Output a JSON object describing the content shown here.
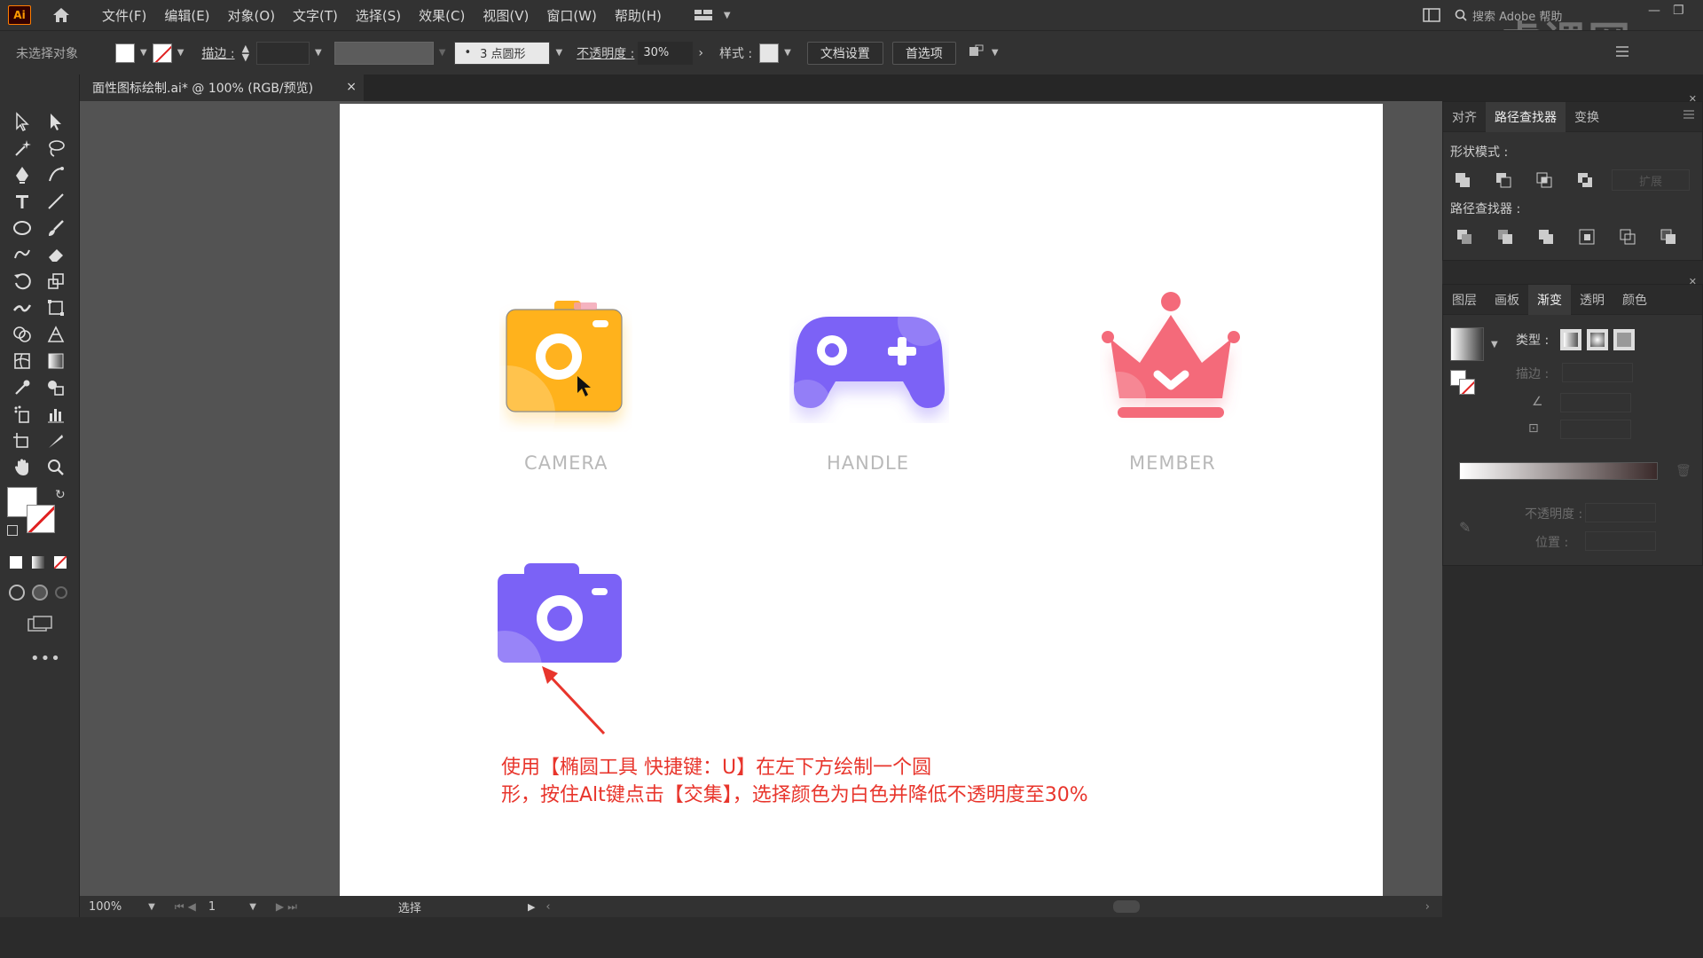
{
  "menubar": {
    "logo": "Ai",
    "items": [
      "文件(F)",
      "编辑(E)",
      "对象(O)",
      "文字(T)",
      "选择(S)",
      "效果(C)",
      "视图(V)",
      "窗口(W)",
      "帮助(H)"
    ],
    "search_placeholder": "搜索 Adobe 帮助"
  },
  "watermark": "虎课网",
  "control": {
    "no_selection": "未选择对象",
    "stroke_label": "描边 :",
    "brush": "3 点圆形",
    "opacity_label": "不透明度 :",
    "opacity_value": "30%",
    "style_label": "样式 :",
    "doc_setup": "文档设置",
    "prefs": "首选项"
  },
  "document": {
    "tab_title": "面性图标绘制.ai* @ 100% (RGB/预览)",
    "close": "×"
  },
  "artboard": {
    "labels": [
      "CAMERA",
      "HANDLE",
      "MEMBER"
    ],
    "instruction_line1": "使用【椭圆工具 快捷键：U】在左下方绘制一个圆",
    "instruction_line2": "形，按住Alt键点击【交集】，选择颜色为白色并降低不透明度至30%",
    "colors": {
      "camera_yellow": "#ffb21f",
      "purple": "#7b62f6",
      "red": "#f46a7a",
      "arrow": "#e8352c"
    }
  },
  "status": {
    "zoom": "100%",
    "page": "1",
    "tool": "选择"
  },
  "panel_top": {
    "tabs": [
      "对齐",
      "路径查找器",
      "变换"
    ],
    "shape_modes_label": "形状模式 :",
    "expand_label": "扩展",
    "pathfinders_label": "路径查找器 :"
  },
  "panel_bottom": {
    "tabs": [
      "图层",
      "画板",
      "渐变",
      "透明",
      "颜色"
    ],
    "type_label": "类型 :",
    "stroke_label": "描边 :",
    "opacity_label": "不透明度 :",
    "position_label": "位置 :"
  }
}
